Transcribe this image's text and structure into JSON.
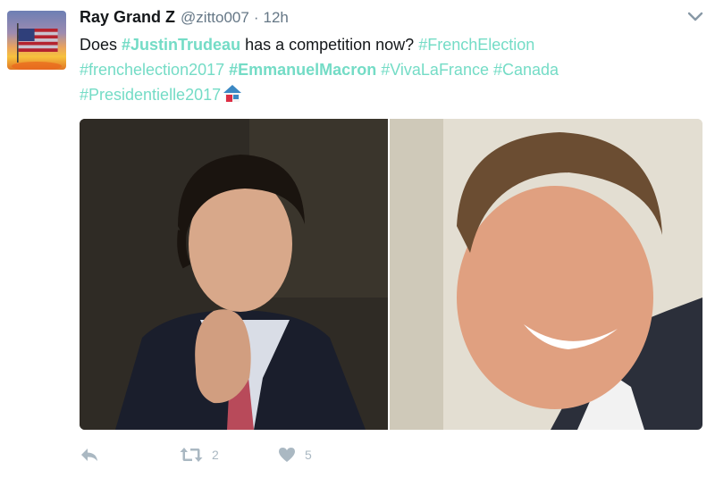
{
  "tweet": {
    "author": {
      "display_name": "Ray Grand Z",
      "handle": "@zitto007"
    },
    "separator": "·",
    "time": "12h",
    "text_segments": [
      {
        "text": "Does ",
        "kind": "word"
      },
      {
        "text": "#JustinTrudeau",
        "kind": "tag-bold"
      },
      {
        "text": " has a competition now? ",
        "kind": "word"
      },
      {
        "text": "#FrenchElection",
        "kind": "tag"
      },
      {
        "text": " ",
        "kind": "word"
      },
      {
        "text": "#frenchelection2017",
        "kind": "tag"
      },
      {
        "text": " ",
        "kind": "word"
      },
      {
        "text": "#EmmanuelMacron",
        "kind": "tag-bold"
      },
      {
        "text": " ",
        "kind": "word"
      },
      {
        "text": "#VivaLaFrance",
        "kind": "tag"
      },
      {
        "text": " ",
        "kind": "word"
      },
      {
        "text": "#Canada",
        "kind": "tag"
      },
      {
        "text": " ",
        "kind": "word"
      },
      {
        "text": "#Presidentielle2017",
        "kind": "tag"
      }
    ],
    "emoji": "house-icon",
    "actions": {
      "reply_icon": "reply-icon",
      "retweet_icon": "retweet-icon",
      "retweet_count": "2",
      "like_icon": "heart-icon",
      "like_count": "5"
    },
    "menu_icon": "chevron-down-icon"
  },
  "colors": {
    "hashtag": "#74dcc6",
    "text": "#14171a",
    "muted": "#657786",
    "action_icon": "#aab8c2"
  }
}
